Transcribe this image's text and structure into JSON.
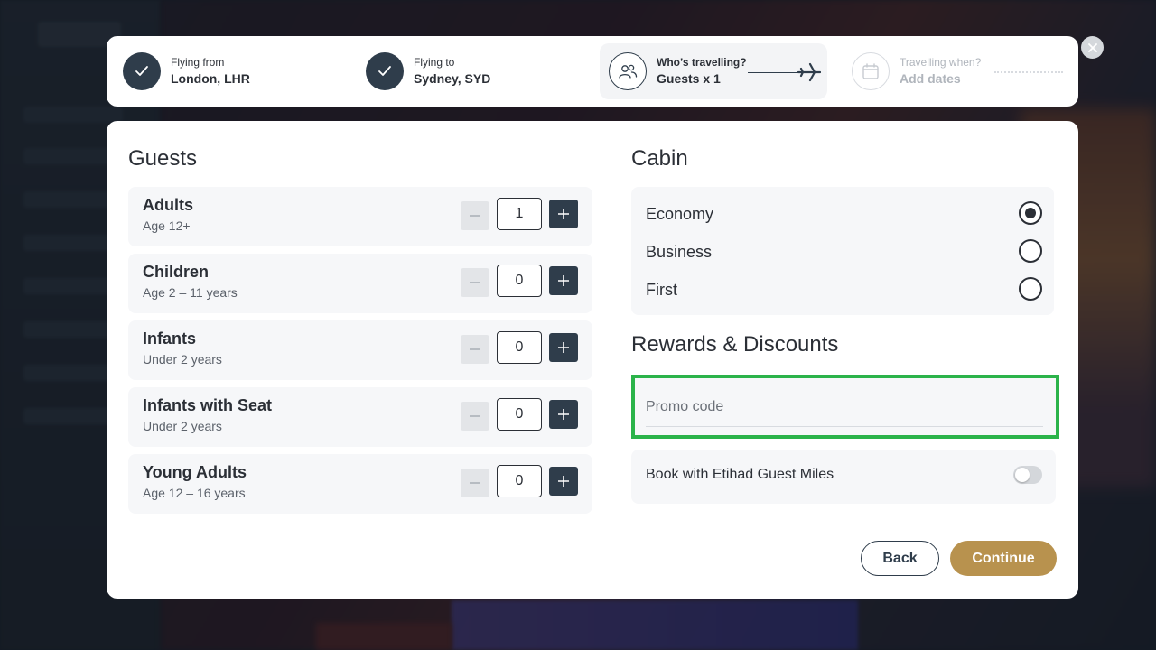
{
  "steps": [
    {
      "label": "Flying from",
      "value": "London, LHR",
      "state": "done"
    },
    {
      "label": "Flying to",
      "value": "Sydney, SYD",
      "state": "done"
    },
    {
      "label": "Who’s travelling?",
      "value": "Guests x 1",
      "state": "active"
    },
    {
      "label": "Travelling when?",
      "value": "Add dates",
      "state": "upcoming"
    }
  ],
  "guests": {
    "title": "Guests",
    "rows": [
      {
        "name": "Adults",
        "age": "Age 12+",
        "count": "1"
      },
      {
        "name": "Children",
        "age": "Age 2 – 11 years",
        "count": "0"
      },
      {
        "name": "Infants",
        "age": "Under 2 years",
        "count": "0"
      },
      {
        "name": "Infants with Seat",
        "age": "Under 2 years",
        "count": "0"
      },
      {
        "name": "Young Adults",
        "age": "Age 12 – 16 years",
        "count": "0"
      }
    ]
  },
  "cabin": {
    "title": "Cabin",
    "options": [
      {
        "label": "Economy",
        "selected": true
      },
      {
        "label": "Business",
        "selected": false
      },
      {
        "label": "First",
        "selected": false
      }
    ]
  },
  "rewards": {
    "title": "Rewards & Discounts",
    "promo_placeholder": "Promo code",
    "promo_value": "",
    "miles_label": "Book with Etihad Guest Miles",
    "miles_enabled": false
  },
  "actions": {
    "back_label": "Back",
    "continue_label": "Continue"
  },
  "colors": {
    "primary_dark": "#2f3d4b",
    "accent_gold": "#b8924e",
    "highlight_green": "#2bb34a"
  },
  "icons": {
    "close": "close-icon",
    "done_step": "check-icon",
    "guests_step": "people-icon",
    "dates_step": "calendar-icon",
    "journey": "airplane-icon"
  }
}
